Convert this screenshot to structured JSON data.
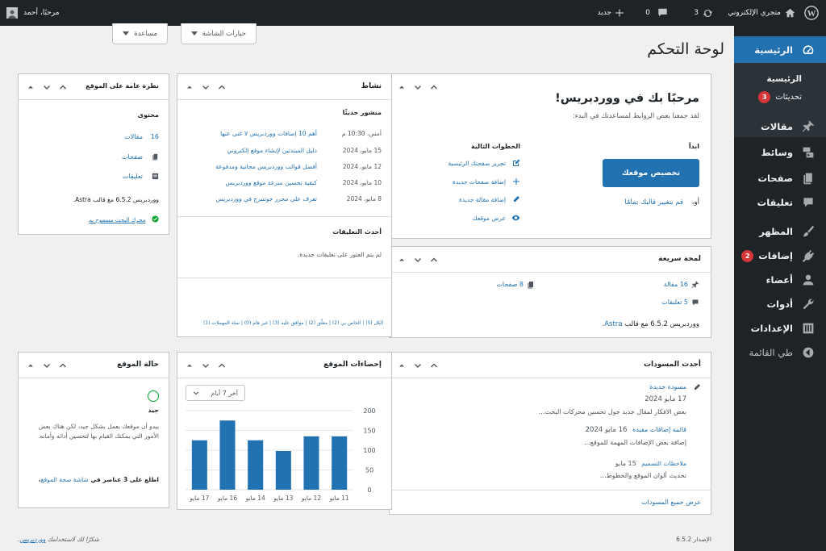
{
  "adminbar": {
    "site_name": "متجري الإلكتروني",
    "updates_count": "3",
    "comments_count": "0",
    "new_label": "جديد",
    "greeting": "مرحبًا، أحمد"
  },
  "menu": {
    "dashboard": "الرئيسية",
    "sub_home": "الرئيسية",
    "sub_updates": "تحديثات",
    "sub_updates_badge": "3",
    "posts": "مقالات",
    "media": "وسائط",
    "pages": "صفحات",
    "comments": "تعليقات",
    "appearance": "المظهر",
    "plugins": "إضافات",
    "plugins_badge": "2",
    "users": "أعضاء",
    "tools": "أدوات",
    "settings": "الإعدادات",
    "collapse": "طي القائمة"
  },
  "screen_tabs": {
    "screen_options": "خيارات الشاشة",
    "help": "مساعدة"
  },
  "page_title": "لوحة التحكم",
  "welcome": {
    "title": "مرحبًا بك في ووردبريس!",
    "subtitle": "لقد جمعنا بعض الروابط لمساعدتك في البدء:",
    "start_heading": "ابدأ",
    "customize_button": "تخصيص موقعك",
    "or_label": "أو،",
    "change_theme_link": "قم بتغيير قالبك تمامًا",
    "next_steps_heading": "الخطوات التالية",
    "next_steps": [
      "تحرير صفحتك الرئيسية",
      "إضافة صفحات جديدة",
      "إضافة مقالة جديدة",
      "عرض موقعك"
    ]
  },
  "glance": {
    "title": "لمحة سريعة",
    "posts": "16 مقالة",
    "pages": "8 صفحات",
    "comments": "5 تعليقات",
    "version_line": "ووردبريس 6.5.2 مع قالب",
    "theme_name": "Astra",
    "version_end": "."
  },
  "activity": {
    "title": "نشاط",
    "recent_heading": "منشور حديثًا",
    "recent": [
      {
        "date": "أمس، 10:30 م",
        "title": "أهم 10 إضافات ووردبريس لا غنى عنها"
      },
      {
        "date": "15 مايو، 2024",
        "title": "دليل المبتدئين لإنشاء موقع إلكتروني"
      },
      {
        "date": "12 مايو، 2024",
        "title": "أفضل قوالب ووردبريس مجانية ومدفوعة"
      },
      {
        "date": "10 مايو، 2024",
        "title": "كيفية تحسين سرعة موقع ووردبريس"
      },
      {
        "date": "8 مايو، 2024",
        "title": "تعرف على محرر جوتنبرج في ووردبريس"
      }
    ],
    "comments_heading": "أحدث التعليقات",
    "no_comments": "لم يتم العثور على تعليقات جديدة.",
    "filters": "الكل (5) | الخاص بي (2) | معلّق (2) | موافق عليه (3) | غير هام (0) | سلة المهملات (1)"
  },
  "overview": {
    "title": "نظرة عامة على الموقع",
    "content_heading": "محتوى",
    "posts_count": "16",
    "posts_label": "مقالات",
    "pages_label": "صفحات",
    "comments_label": "تعليقات",
    "version_line": "ووردبريس 6.5.2 مع قالب Astra.",
    "search_engines": "محرك البحث مسموح به"
  },
  "drafts": {
    "title": "أحدث المسودات",
    "items": [
      {
        "title": "مسودة جديدة",
        "date": "17 مايو 2024",
        "excerpt": "بعض الافكار لمقال جديد جول تحسين محركات البحث..."
      },
      {
        "title": "قائمة إضافات مفيدة",
        "date": "16 مايو 2024",
        "excerpt": "إضافة بعض الإضافات المهمة للموقع..."
      },
      {
        "title": "ملاحظات التصميم",
        "date": "15 مايو",
        "excerpt": "تحديث ألوان الموقع والخطوط..."
      }
    ],
    "view_all": "عرض جميع المسودات"
  },
  "stats": {
    "title": "إحصاءات الموقع",
    "range_select": "آخر 7 أيام"
  },
  "health": {
    "title": "حالة الموقع",
    "status": "جيد",
    "description": "يبدو أن موقعك يعمل بشكل جيد، لكن هناك بعض الأمور التي يمكنك القيام بها لتحسين أدائه وأمانه.",
    "cta_prefix": "اطلع على 3 عناصر في",
    "cta_link": "شاشة صحة الموقع",
    "cta_suffix": "."
  },
  "footer": {
    "thanks": "شكرًا لك لاستخدامك",
    "wp_link": "ووردبريس",
    "thanks_end": ".",
    "version": "الإصدار 6.5.2"
  },
  "colors": {
    "accent": "#2271b1",
    "admin_bar": "#1d2327",
    "badge": "#d63638",
    "chart_bar": "#2271b1",
    "good_status": "#00a32a"
  },
  "chart_data": {
    "type": "bar",
    "categories": [
      "17 مايو",
      "16 مايو",
      "14 مايو",
      "13 مايو",
      "12 مايو",
      "11 مايو"
    ],
    "values": [
      125,
      175,
      125,
      98,
      135,
      135
    ],
    "ylim": [
      0,
      200
    ],
    "yticks": [
      0,
      50,
      100,
      150,
      200
    ],
    "grid": true,
    "title": "",
    "xlabel": "",
    "ylabel": ""
  }
}
